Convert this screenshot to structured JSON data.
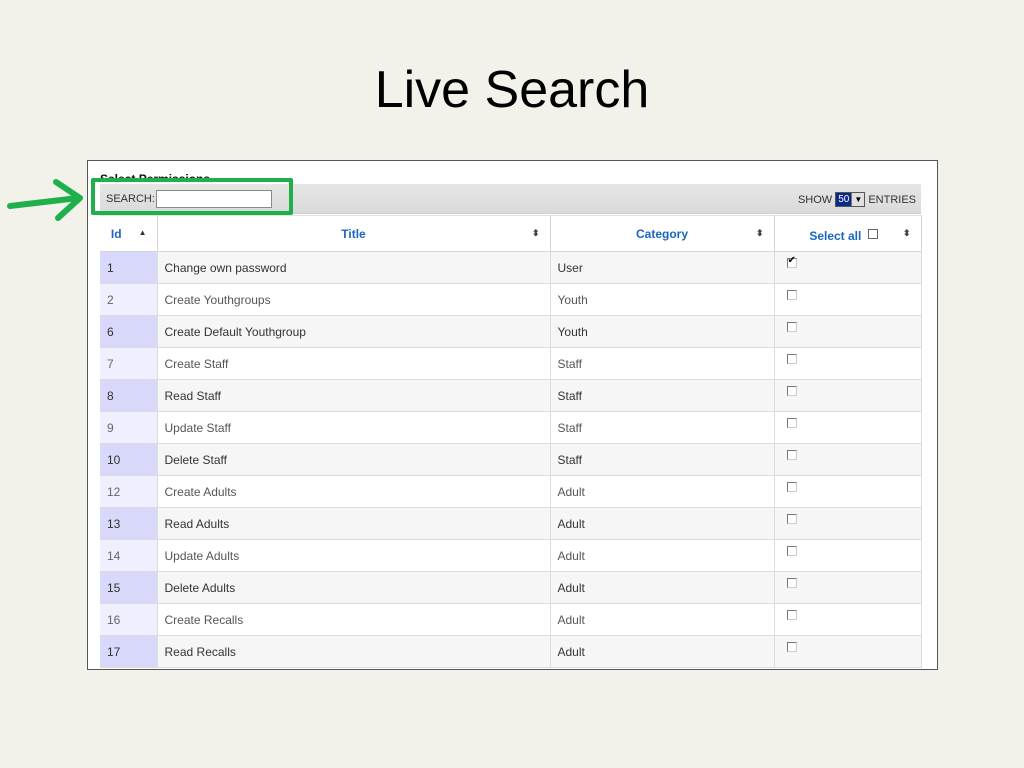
{
  "slide": {
    "title": "Live Search"
  },
  "panel": {
    "heading": "Select Permissions",
    "search_label": "SEARCH:",
    "search_value": "",
    "show_label": "SHOW",
    "show_value": "50",
    "entries_label": "ENTRIES"
  },
  "table": {
    "columns": [
      "Id",
      "Title",
      "Category",
      "Select all"
    ],
    "sort": {
      "column": "Id",
      "direction": "ascending"
    },
    "rows": [
      {
        "id": "1",
        "title": "Change own password",
        "category": "User",
        "checked": true
      },
      {
        "id": "2",
        "title": "Create Youthgroups",
        "category": "Youth",
        "checked": false
      },
      {
        "id": "6",
        "title": "Create Default Youthgroup",
        "category": "Youth",
        "checked": false
      },
      {
        "id": "7",
        "title": "Create Staff",
        "category": "Staff",
        "checked": false
      },
      {
        "id": "8",
        "title": "Read Staff",
        "category": "Staff",
        "checked": false
      },
      {
        "id": "9",
        "title": "Update Staff",
        "category": "Staff",
        "checked": false
      },
      {
        "id": "10",
        "title": "Delete Staff",
        "category": "Staff",
        "checked": false
      },
      {
        "id": "12",
        "title": "Create Adults",
        "category": "Adult",
        "checked": false
      },
      {
        "id": "13",
        "title": "Read Adults",
        "category": "Adult",
        "checked": false
      },
      {
        "id": "14",
        "title": "Update Adults",
        "category": "Adult",
        "checked": false
      },
      {
        "id": "15",
        "title": "Delete Adults",
        "category": "Adult",
        "checked": false
      },
      {
        "id": "16",
        "title": "Create Recalls",
        "category": "Adult",
        "checked": false
      },
      {
        "id": "17",
        "title": "Read Recalls",
        "category": "Adult",
        "checked": false
      }
    ]
  },
  "colors": {
    "annotation": "#1fb04b",
    "header_text": "#1a66c2",
    "id_highlight": "#d8d8fb"
  },
  "icons": {
    "annotation_arrow": "arrow-right-icon",
    "sort": "sort-icon",
    "dropdown": "chevron-down-icon"
  }
}
